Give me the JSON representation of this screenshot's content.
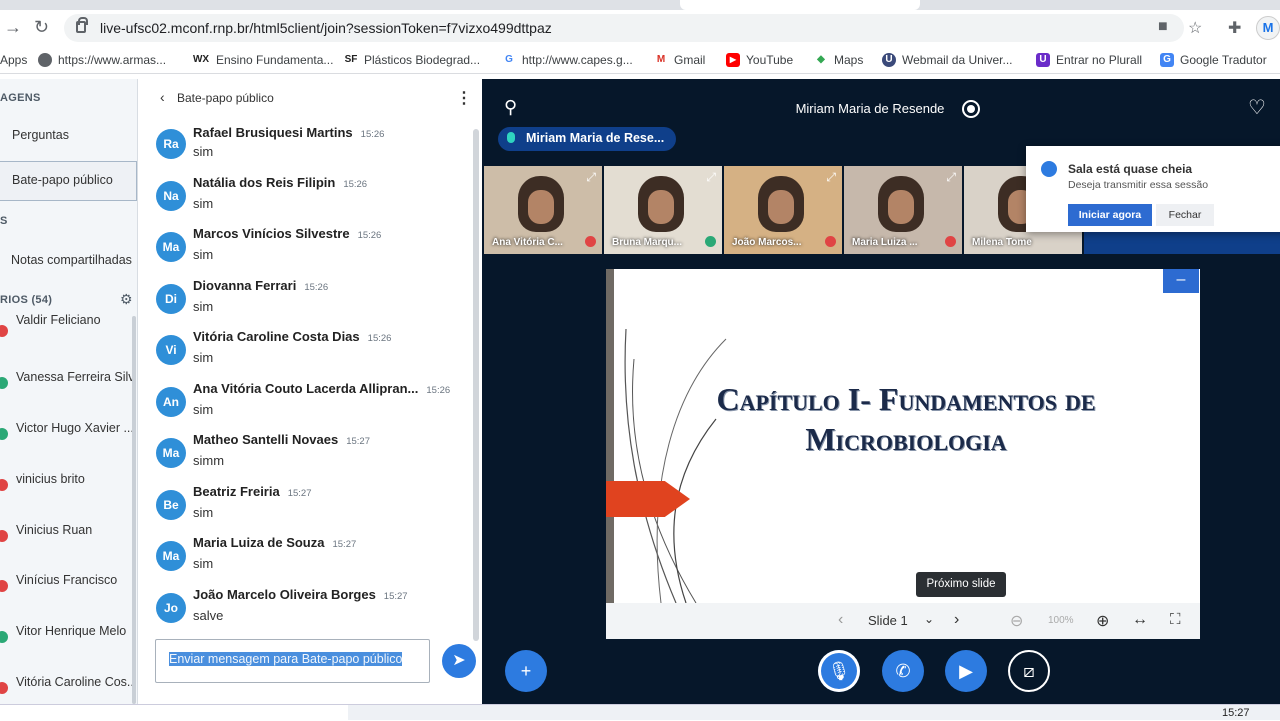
{
  "browser": {
    "url": "live-ufsc02.mconf.rnp.br/html5client/join?sessionToken=f7vizxo499dttpaz",
    "profile_initial": "M"
  },
  "bookmarks": [
    {
      "label": "Apps",
      "icon": "apps-icon"
    },
    {
      "label": "https://www.armas...",
      "icon": "globe-icon"
    },
    {
      "label": "Ensino Fundamenta...",
      "icon": "wix-icon",
      "fav": "WX",
      "color": "#222"
    },
    {
      "label": "Plásticos Biodegrad...",
      "icon": "sf-icon",
      "fav": "SF",
      "color": "#222"
    },
    {
      "label": "http://www.capes.g...",
      "icon": "google-icon",
      "fav": "G",
      "color": "#4285f4"
    },
    {
      "label": "Gmail",
      "icon": "gmail-icon",
      "fav": "M",
      "color": "#d93025"
    },
    {
      "label": "YouTube",
      "icon": "youtube-icon",
      "fav": "▶",
      "color": "#ff0000"
    },
    {
      "label": "Maps",
      "icon": "maps-icon",
      "fav": "◆",
      "color": "#34a853"
    },
    {
      "label": "Webmail da Univer...",
      "icon": "webmail-icon",
      "fav": "U",
      "color": "#3b4a7a"
    },
    {
      "label": "Entrar no Plurall",
      "icon": "plurall-icon",
      "fav": "U",
      "color": "#6a2cc9"
    },
    {
      "label": "Google Tradutor",
      "icon": "translate-icon",
      "fav": "G",
      "color": "#4285f4"
    }
  ],
  "sidebar": {
    "section_messages": "AGENS",
    "questions": "Perguntas",
    "public_chat": "Bate-papo público",
    "section_notes": "S",
    "shared_notes": "Notas compartilhadas",
    "users_header": "RIOS (54)",
    "users": [
      {
        "name": "Valdir Feliciano",
        "status": "#e04444"
      },
      {
        "name": "Vanessa Ferreira Silva",
        "status": "#2aa876"
      },
      {
        "name": "Victor Hugo Xavier ...",
        "status": "#2aa876"
      },
      {
        "name": "vinicius brito",
        "status": "#e04444"
      },
      {
        "name": "Vinicius Ruan",
        "status": "#e04444"
      },
      {
        "name": "Vinícius Francisco",
        "status": "#e04444"
      },
      {
        "name": "Vitor Henrique Melo",
        "status": "#2aa876"
      },
      {
        "name": "Vitória Caroline Cos...",
        "status": "#e04444"
      }
    ]
  },
  "chat": {
    "title": "Bate-papo público",
    "messages": [
      {
        "initials": "Ra",
        "name": "Rafael Brusiquesi Martins",
        "time": "15:26",
        "text": "sim"
      },
      {
        "initials": "Na",
        "name": "Natália dos Reis Filipin",
        "time": "15:26",
        "text": "sim"
      },
      {
        "initials": "Ma",
        "name": "Marcos Vinícios Silvestre",
        "time": "15:26",
        "text": "sim"
      },
      {
        "initials": "Di",
        "name": "Diovanna Ferrari",
        "time": "15:26",
        "text": "sim"
      },
      {
        "initials": "Vi",
        "name": "Vitória Caroline Costa Dias",
        "time": "15:26",
        "text": "sim"
      },
      {
        "initials": "An",
        "name": "Ana Vitória Couto Lacerda Allipran...",
        "time": "15:26",
        "text": "sim"
      },
      {
        "initials": "Ma",
        "name": "Matheo Santelli Novaes",
        "time": "15:27",
        "text": "simm"
      },
      {
        "initials": "Be",
        "name": "Beatriz Freiria",
        "time": "15:27",
        "text": "sim"
      },
      {
        "initials": "Ma",
        "name": "Maria Luiza de Souza",
        "time": "15:27",
        "text": "sim"
      },
      {
        "initials": "Jo",
        "name": "João Marcelo Oliveira Borges",
        "time": "15:27",
        "text": "salve"
      }
    ],
    "input_placeholder": "Enviar mensagem para Bate-papo público"
  },
  "main": {
    "presenter": "Miriam Maria de Resende",
    "talking": "Miriam Maria de Rese...",
    "videos": [
      {
        "name": "Ana Vitória C...",
        "bg": "#cdbda8"
      },
      {
        "name": "Bruna Marqu...",
        "bg": "#e3ddd2"
      },
      {
        "name": "João Marcos...",
        "bg": "#d5b184"
      },
      {
        "name": "Maria Luiza ...",
        "bg": "#c6b8ab"
      },
      {
        "name": "Milena Tome",
        "bg": "#d9d2c8"
      }
    ],
    "toast": {
      "title": "Sala está quase cheia",
      "text": "Deseja transmitir essa sessão",
      "primary": "Iniciar agora",
      "secondary": "Fechar"
    },
    "slide_title_line1": "Capítulo I- Fundamentos de",
    "slide_title_line2": "Microbiologia",
    "slide_label": "Slide 1",
    "zoom": "100%",
    "tooltip": "Próximo slide"
  },
  "taskbar": {
    "time": "15:27"
  }
}
